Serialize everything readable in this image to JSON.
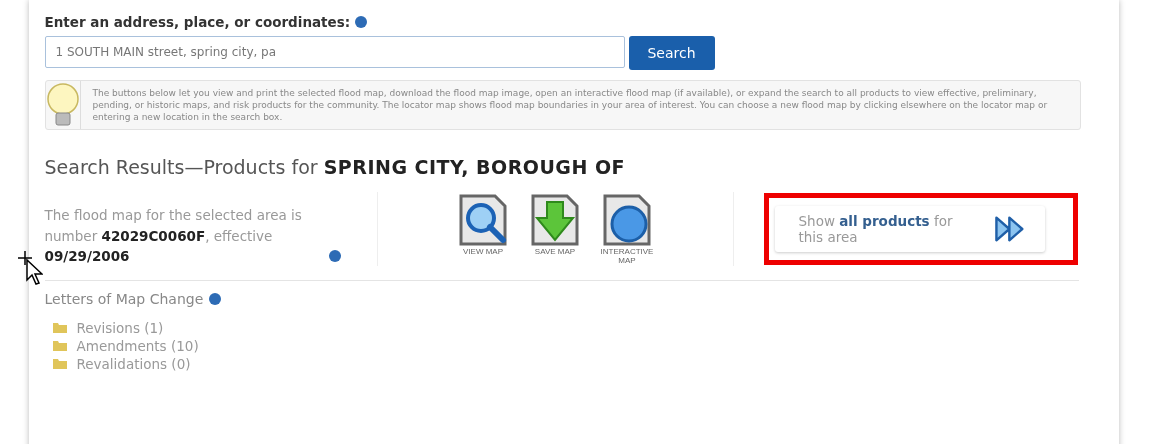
{
  "address_label": "Enter an address, place, or coordinates:",
  "search": {
    "value": "1 SOUTH MAIN street, spring city, pa",
    "button": "Search"
  },
  "info_text": "The buttons below let you view and print the selected flood map, download the flood map image, open an interactive flood map (if available), or expand the search to all products to view effective, preliminary, pending, or historic maps, and risk products for the community. The locator map shows flood map boundaries in your area of interest. You can choose a new flood map by clicking elsewhere on the locator map or entering a new location in the search box.",
  "results_title": "Search Results—Products for **SPRING CITY, BOROUGH OF**",
  "flood_map_text": "The flood map for the selected area is number **42029C0060F**, effective **09/29/2006**",
  "map_buttons": [
    {
      "kind": "view",
      "label": "VIEW MAP"
    },
    {
      "kind": "save",
      "label": "SAVE MAP"
    },
    {
      "kind": "interactive",
      "label": "INTERACTIVE MAP"
    }
  ],
  "all_products": {
    "text": "Show **all products** for this area",
    "highlighted": true
  },
  "lomc": {
    "title": "Letters of Map Change",
    "items": [
      "Revisions (1)",
      "Amendments (10)",
      "Revalidations (0)"
    ]
  }
}
